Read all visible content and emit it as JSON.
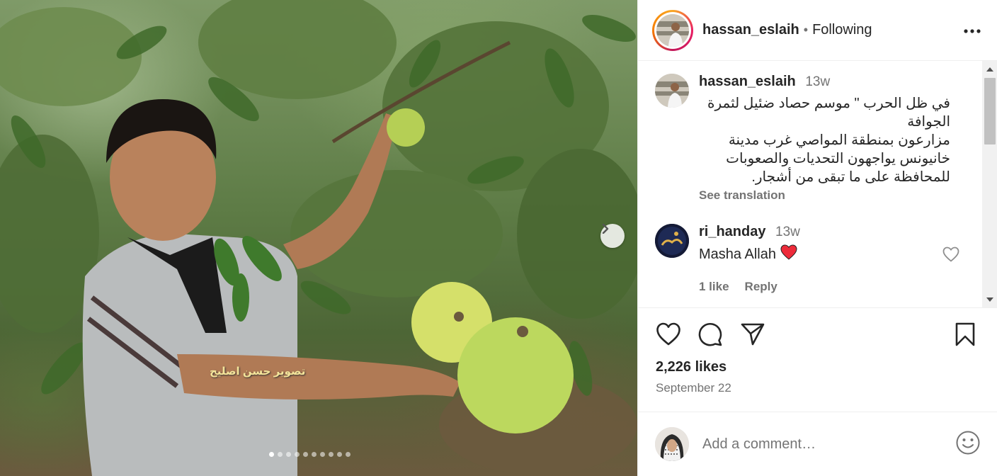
{
  "post": {
    "photo_watermark": "تصوير حسن اصليح",
    "carousel_count": 10,
    "carousel_active": 0
  },
  "header": {
    "username": "hassan_eslaih",
    "separator": "•",
    "follow_status": "Following",
    "more_icon": "more-horizontal-icon"
  },
  "caption": {
    "username": "hassan_eslaih",
    "time": "13w",
    "text_lines": [
      "في ظل الحرب \" موسم حصاد ضئيل لثمرة",
      "الجوافة",
      "مزارعون بمنطقة المواصي غرب مدينة",
      "خانيونس يواجهون التحديات والصعوبات",
      "للمحافظة على ما تبقى من أشجار."
    ],
    "see_translation": "See translation"
  },
  "comment": {
    "username": "ri_handay",
    "time": "13w",
    "text": "Masha Allah",
    "emoji": "❤️",
    "likes_label": "1 like",
    "reply_label": "Reply"
  },
  "actions": {
    "icons": [
      "heart-icon",
      "comment-icon",
      "share-icon",
      "bookmark-icon"
    ]
  },
  "stats": {
    "likes": "2,226 likes",
    "date": "September 22"
  },
  "add_comment": {
    "placeholder": "Add a comment…"
  },
  "colors": {
    "text": "#262626",
    "muted": "#737373",
    "heart_red": "#ed2b3a",
    "border": "#efefef"
  }
}
